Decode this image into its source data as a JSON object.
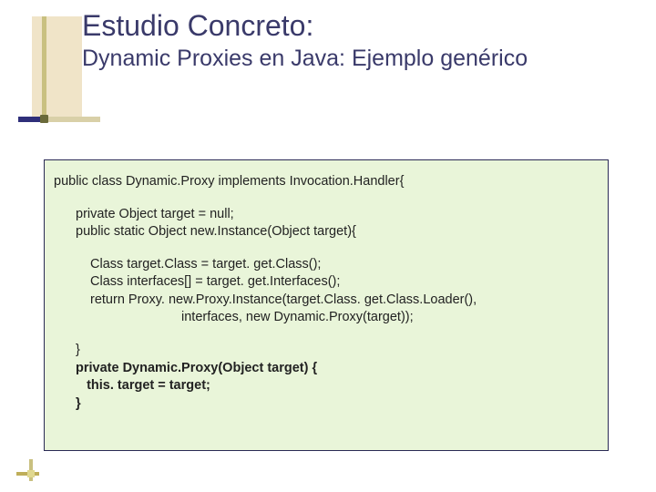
{
  "title": {
    "main": "Estudio Concreto:",
    "sub": "Dynamic Proxies en Java: Ejemplo genérico"
  },
  "code": {
    "line1": "public class Dynamic.Proxy implements Invocation.Handler{",
    "line2": "private Object target = null;",
    "line3": "public static Object new.Instance(Object target){",
    "line4": "Class target.Class = target. get.Class();",
    "line5": "Class interfaces[] = target. get.Interfaces();",
    "line6": "return Proxy. new.Proxy.Instance(target.Class. get.Class.Loader(),",
    "line7": "interfaces, new Dynamic.Proxy(target));",
    "line8": "}",
    "line9": "private Dynamic.Proxy(Object target) {",
    "line10": "   this. target = target;",
    "line11": "}"
  }
}
